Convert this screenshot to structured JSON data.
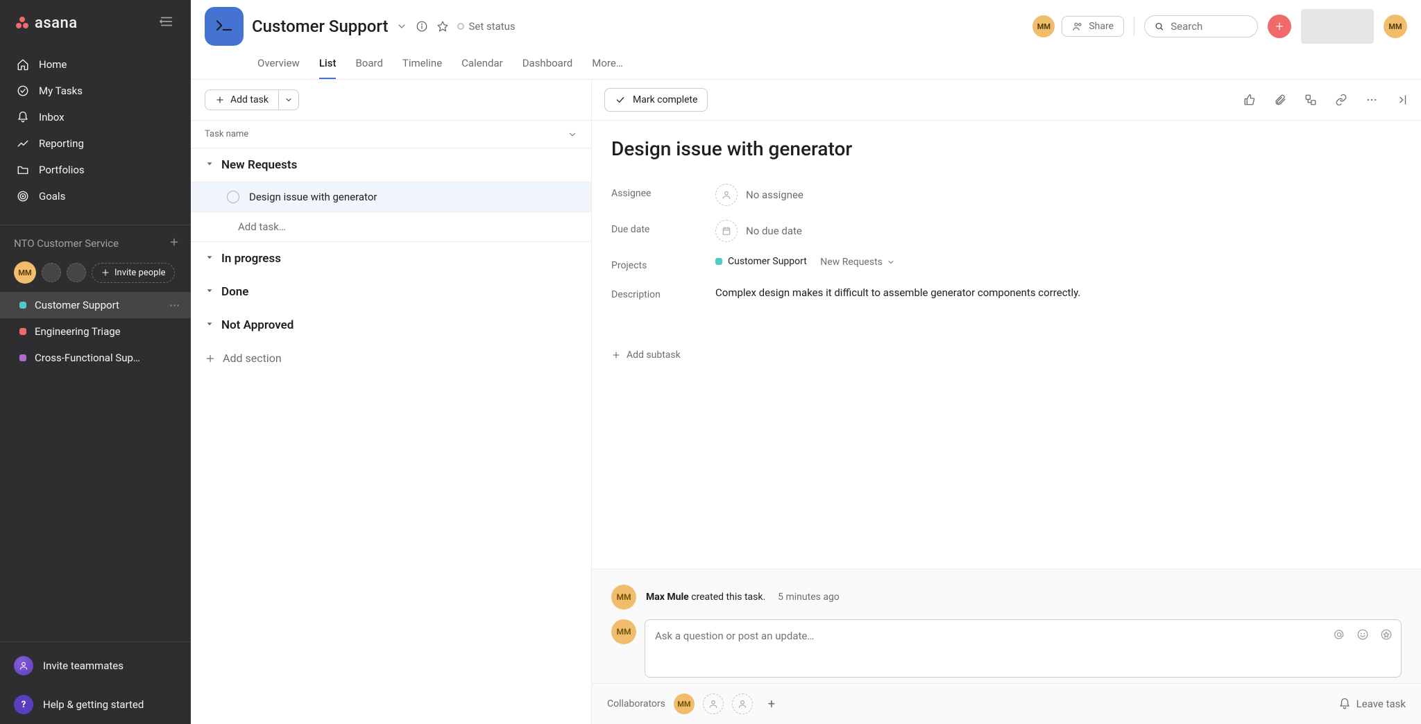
{
  "brand": "asana",
  "sidebar": {
    "nav": [
      {
        "label": "Home",
        "icon": "home"
      },
      {
        "label": "My Tasks",
        "icon": "check"
      },
      {
        "label": "Inbox",
        "icon": "bell"
      },
      {
        "label": "Reporting",
        "icon": "chart"
      },
      {
        "label": "Portfolios",
        "icon": "folder"
      },
      {
        "label": "Goals",
        "icon": "target"
      }
    ],
    "team_name": "NTO Customer Service",
    "invite_label": "Invite people",
    "avatar": "MM",
    "projects": [
      {
        "label": "Customer Support",
        "color": "#4ecbc4",
        "active": true
      },
      {
        "label": "Engineering Triage",
        "color": "#f06a6a",
        "active": false
      },
      {
        "label": "Cross-Functional Sup…",
        "color": "#b36bd4",
        "active": false
      }
    ],
    "invite_team": "Invite teammates",
    "help": "Help & getting started"
  },
  "header": {
    "project_title": "Customer Support",
    "status_label": "Set status",
    "share_label": "Share",
    "search_placeholder": "Search",
    "avatar": "MM",
    "tabs": [
      "Overview",
      "List",
      "Board",
      "Timeline",
      "Calendar",
      "Dashboard",
      "More…"
    ],
    "active_tab": "List"
  },
  "list": {
    "add_task": "Add task",
    "column_header": "Task name",
    "sections": [
      "New Requests",
      "In progress",
      "Done",
      "Not Approved"
    ],
    "task": "Design issue with generator",
    "add_task_placeholder": "Add task…",
    "add_section": "Add section"
  },
  "detail": {
    "mark_complete": "Mark complete",
    "title": "Design issue with generator",
    "fields": {
      "assignee_label": "Assignee",
      "assignee_value": "No assignee",
      "due_label": "Due date",
      "due_value": "No due date",
      "projects_label": "Projects",
      "project_tag": "Customer Support",
      "section_tag": "New Requests",
      "desc_label": "Description",
      "desc_value": "Complex design makes it difficult to assemble generator components correctly."
    },
    "add_subtask": "Add subtask",
    "activity": {
      "avatar": "MM",
      "actor": "Max Mule",
      "text": " created this task.",
      "when": "5 minutes ago"
    },
    "comment_placeholder": "Ask a question or post an update…",
    "footer": {
      "collab_label": "Collaborators",
      "avatar": "MM",
      "leave": "Leave task"
    }
  }
}
